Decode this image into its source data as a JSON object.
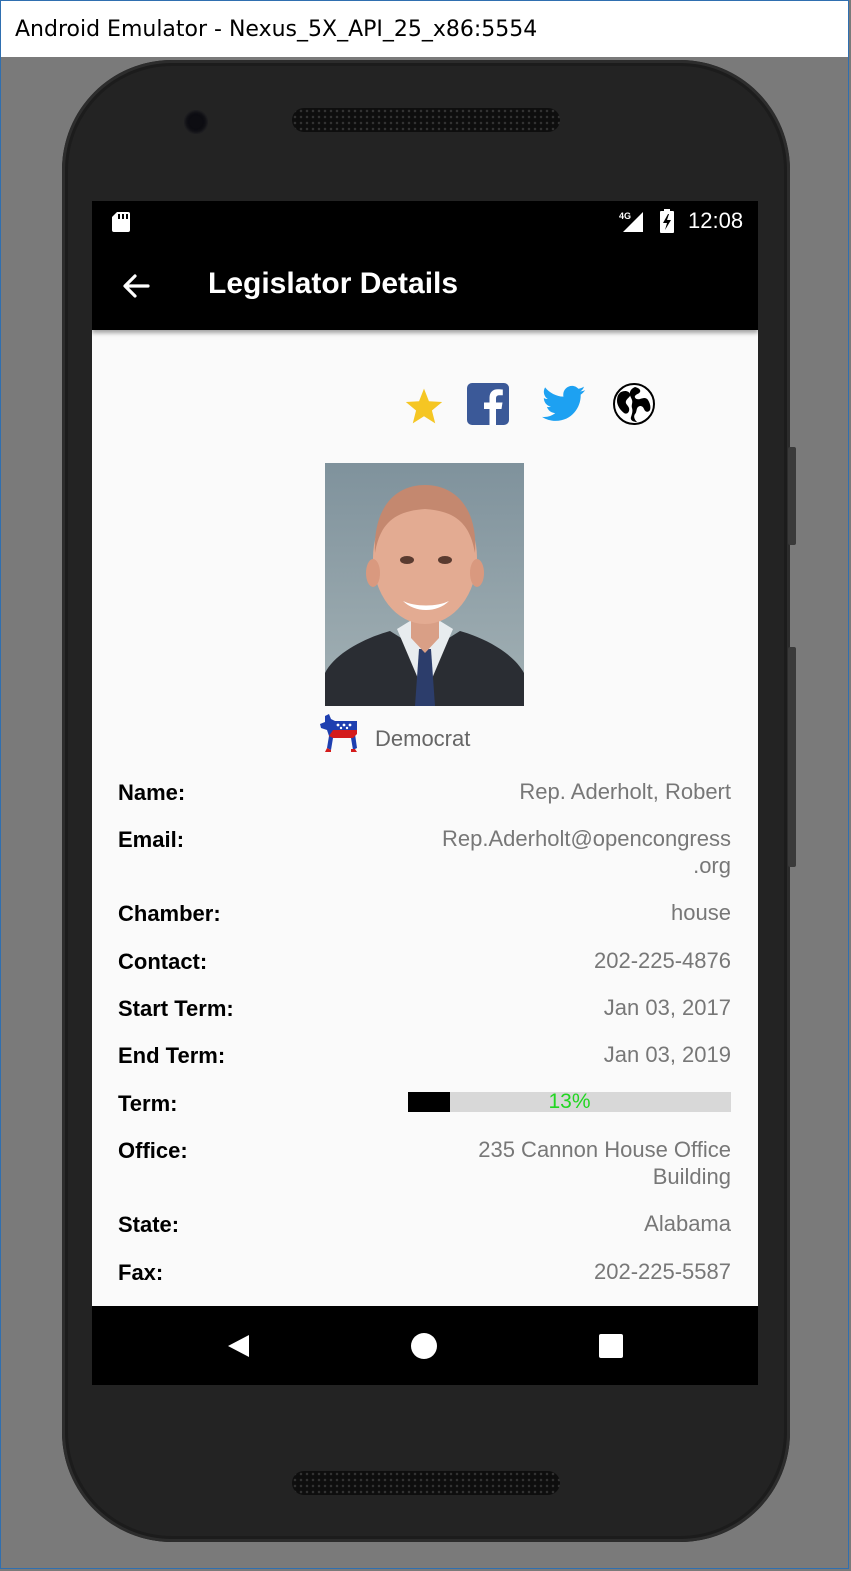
{
  "window": {
    "title": "Android Emulator - Nexus_5X_API_25_x86:5554"
  },
  "statusbar": {
    "network": "4G",
    "time": "12:08"
  },
  "appbar": {
    "title": "Legislator Details"
  },
  "actions": [
    {
      "name": "favorite-star-icon",
      "color": "#F5C623"
    },
    {
      "name": "facebook-icon",
      "color": "#3b5998"
    },
    {
      "name": "twitter-icon",
      "color": "#1da1f2"
    },
    {
      "name": "website-globe-icon",
      "color": "#000000"
    }
  ],
  "party": {
    "label": "Democrat"
  },
  "details": {
    "name": {
      "label": "Name:",
      "value": "Rep. Aderholt, Robert"
    },
    "email": {
      "label": "Email:",
      "value_line1": "Rep.Aderholt@opencongress",
      "value_line2": ".org"
    },
    "chamber": {
      "label": "Chamber:",
      "value": "house"
    },
    "contact": {
      "label": "Contact:",
      "value": "202-225-4876"
    },
    "start_term": {
      "label": "Start Term:",
      "value": "Jan 03, 2017"
    },
    "end_term": {
      "label": "End Term:",
      "value": "Jan 03, 2019"
    },
    "term": {
      "label": "Term:",
      "progress_text": "13%",
      "progress_value": 0.13
    },
    "office": {
      "label": "Office:",
      "value_line1": "235 Cannon House Office",
      "value_line2": "Building"
    },
    "state": {
      "label": "State:",
      "value": "Alabama"
    },
    "fax": {
      "label": "Fax:",
      "value": "202-225-5587"
    }
  }
}
